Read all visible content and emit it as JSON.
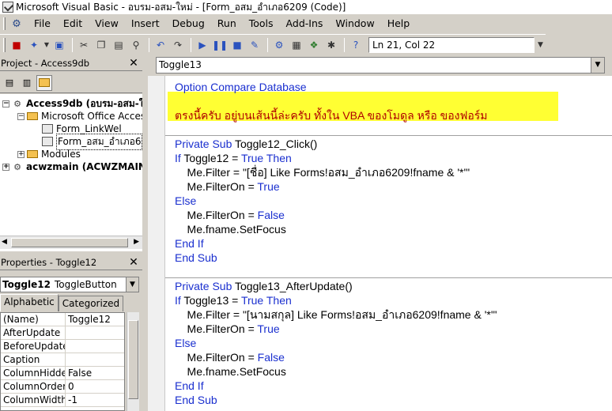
{
  "window": {
    "title": "Microsoft Visual Basic - อบรม-อสม-ใหม่ - [Form_อสม_อำเภอ6209 (Code)]"
  },
  "menu": [
    "File",
    "Edit",
    "View",
    "Insert",
    "Debug",
    "Run",
    "Tools",
    "Add-Ins",
    "Window",
    "Help"
  ],
  "toolbar": {
    "position": "Ln 21, Col 22"
  },
  "project": {
    "title": "Project - Access9db",
    "tree": [
      {
        "label": "Access9db (อบรม-อสม-ใ",
        "bold": true,
        "level": 0,
        "expander": "−",
        "icon": "project"
      },
      {
        "label": "Microsoft Office Access",
        "bold": false,
        "level": 1,
        "expander": "−",
        "icon": "folder"
      },
      {
        "label": "Form_LinkWel",
        "bold": false,
        "level": 2,
        "expander": "",
        "icon": "form"
      },
      {
        "label": "Form_อสม_อำเภอ6",
        "bold": false,
        "level": 2,
        "expander": "",
        "icon": "form",
        "selected": true
      },
      {
        "label": "Modules",
        "bold": false,
        "level": 1,
        "expander": "+",
        "icon": "folder"
      },
      {
        "label": "acwzmain (ACWZMAIN)",
        "bold": true,
        "level": 0,
        "expander": "+",
        "icon": "project"
      }
    ]
  },
  "properties": {
    "title": "Properties - Toggle12",
    "object_name": "Toggle12",
    "object_type": "ToggleButton",
    "tabs": [
      "Alphabetic",
      "Categorized"
    ],
    "rows": [
      {
        "name": "(Name)",
        "value": "Toggle12"
      },
      {
        "name": "AfterUpdate",
        "value": ""
      },
      {
        "name": "BeforeUpdate",
        "value": ""
      },
      {
        "name": "Caption",
        "value": ""
      },
      {
        "name": "ColumnHidden",
        "value": "False"
      },
      {
        "name": "ColumnOrder",
        "value": "0"
      },
      {
        "name": "ColumnWidth",
        "value": "-1"
      }
    ]
  },
  "code": {
    "object_combo": "Toggle13",
    "lines": [
      {
        "segments": [
          {
            "t": "Option Compare Database",
            "c": "kw"
          }
        ]
      },
      {
        "segments": []
      },
      {
        "segments": [
          {
            "t": "ตรงนี้ครับ อยู่บนเส้นนี้ล่ะครับ ทั้งใน VBA ของโมดูล หรือ ของฟอร์ม",
            "c": "cm"
          }
        ]
      },
      {
        "segments": []
      },
      {
        "segments": [
          {
            "t": "Private Sub ",
            "c": "kw"
          },
          {
            "t": "Toggle12_Click()",
            "c": ""
          }
        ]
      },
      {
        "segments": [
          {
            "t": "If ",
            "c": "kw"
          },
          {
            "t": "Toggle12 = ",
            "c": ""
          },
          {
            "t": "True Then",
            "c": "kw"
          }
        ]
      },
      {
        "segments": [
          {
            "t": "    Me.Filter = \"[ชื่อ] Like Forms!อสม_อำเภอ6209!fname & '*'\"",
            "c": ""
          }
        ]
      },
      {
        "segments": [
          {
            "t": "    Me.FilterOn = ",
            "c": ""
          },
          {
            "t": "True",
            "c": "kw"
          }
        ]
      },
      {
        "segments": [
          {
            "t": "Else",
            "c": "kw"
          }
        ]
      },
      {
        "segments": [
          {
            "t": "    Me.FilterOn = ",
            "c": ""
          },
          {
            "t": "False",
            "c": "kw"
          }
        ]
      },
      {
        "segments": [
          {
            "t": "    Me.fname.SetFocus",
            "c": ""
          }
        ]
      },
      {
        "segments": [
          {
            "t": "End If",
            "c": "kw"
          }
        ]
      },
      {
        "segments": [
          {
            "t": "End Sub",
            "c": "kw"
          }
        ]
      },
      {
        "segments": []
      },
      {
        "segments": [
          {
            "t": "Private Sub ",
            "c": "kw"
          },
          {
            "t": "Toggle13_AfterUpdate()",
            "c": ""
          }
        ]
      },
      {
        "segments": [
          {
            "t": "If ",
            "c": "kw"
          },
          {
            "t": "Toggle13 = ",
            "c": ""
          },
          {
            "t": "True Then",
            "c": "kw"
          }
        ]
      },
      {
        "segments": [
          {
            "t": "    Me.Filter = \"[นามสกุล] Like Forms!อสม_อำเภอ6209!fname & '*'\"",
            "c": ""
          }
        ]
      },
      {
        "segments": [
          {
            "t": "    Me.FilterOn = ",
            "c": ""
          },
          {
            "t": "True",
            "c": "kw"
          }
        ]
      },
      {
        "segments": [
          {
            "t": "Else",
            "c": "kw"
          }
        ]
      },
      {
        "segments": [
          {
            "t": "    Me.FilterOn = ",
            "c": ""
          },
          {
            "t": "False",
            "c": "kw"
          }
        ]
      },
      {
        "segments": [
          {
            "t": "    Me.fname.SetFocus",
            "c": ""
          }
        ]
      },
      {
        "segments": [
          {
            "t": "End If",
            "c": "kw"
          }
        ]
      },
      {
        "segments": [
          {
            "t": "End Sub",
            "c": "kw"
          }
        ]
      }
    ]
  },
  "colors": {
    "highlight": "#ffff33",
    "keyword": "#1a2fcf",
    "comment": "#b00000"
  }
}
